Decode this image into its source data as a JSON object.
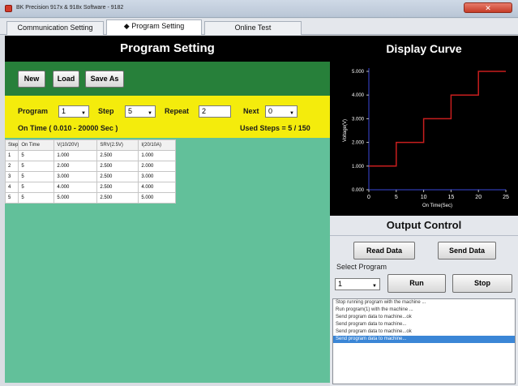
{
  "window": {
    "title": "BK Precision 917x & 918x Software - 9182"
  },
  "tabs": [
    {
      "label": "Communication Setting"
    },
    {
      "label": "◆ Program Setting"
    },
    {
      "label": "Online Test"
    }
  ],
  "left": {
    "title": "Program Setting",
    "buttons": {
      "new": "New",
      "load": "Load",
      "save_as": "Save As"
    },
    "program_label": "Program",
    "program_value": "1",
    "step_label": "Step",
    "step_value": "5",
    "repeat_label": "Repeat",
    "repeat_value": "2",
    "next_label": "Next",
    "next_value": "0",
    "on_time_range": "On Time ( 0.010 - 20000 Sec )",
    "used_steps": "Used Steps = 5 / 150",
    "table": {
      "headers": [
        "Step",
        "On Time",
        "V(10/20V)",
        "SRV(2.5V)",
        "I(20/10A)"
      ],
      "rows": [
        [
          "1",
          "5",
          "1.000",
          "2.500",
          "1.000"
        ],
        [
          "2",
          "5",
          "2.000",
          "2.500",
          "2.000"
        ],
        [
          "3",
          "5",
          "3.000",
          "2.500",
          "3.000"
        ],
        [
          "4",
          "5",
          "4.000",
          "2.500",
          "4.000"
        ],
        [
          "5",
          "5",
          "5.000",
          "2.500",
          "5.000"
        ]
      ]
    }
  },
  "right": {
    "title": "Display Curve",
    "output_title": "Output Control",
    "buttons": {
      "read_data": "Read Data",
      "send_data": "Send Data",
      "run": "Run",
      "stop": "Stop"
    },
    "select_program_label": "Select Program",
    "select_program_value": "1",
    "log": [
      "Stop running program with the machine ...",
      "Run program(1) with the machine ...",
      "Send program data to machine...ok",
      "Send program data to machine...",
      "Send program data to machine...ok",
      "Send program data to machine..."
    ],
    "selected_log_index": 5
  },
  "chart_data": {
    "type": "line",
    "title": "",
    "xlabel": "On Time(Sec)",
    "ylabel": "Voltage(V)",
    "xlim": [
      0,
      25
    ],
    "ylim": [
      0,
      5
    ],
    "xticks": [
      "0",
      "5",
      "10",
      "15",
      "20",
      "25"
    ],
    "yticks": [
      "0.000",
      "1.000",
      "2.000",
      "3.000",
      "4.000",
      "5.000"
    ],
    "series": [
      {
        "color": "#c81e1e",
        "x": [
          0,
          5,
          5,
          10,
          10,
          15,
          15,
          20,
          20,
          25
        ],
        "y": [
          1,
          1,
          2,
          2,
          3,
          3,
          4,
          4,
          5,
          5
        ]
      }
    ],
    "axis_color": "#3a49d8",
    "grid": false
  }
}
